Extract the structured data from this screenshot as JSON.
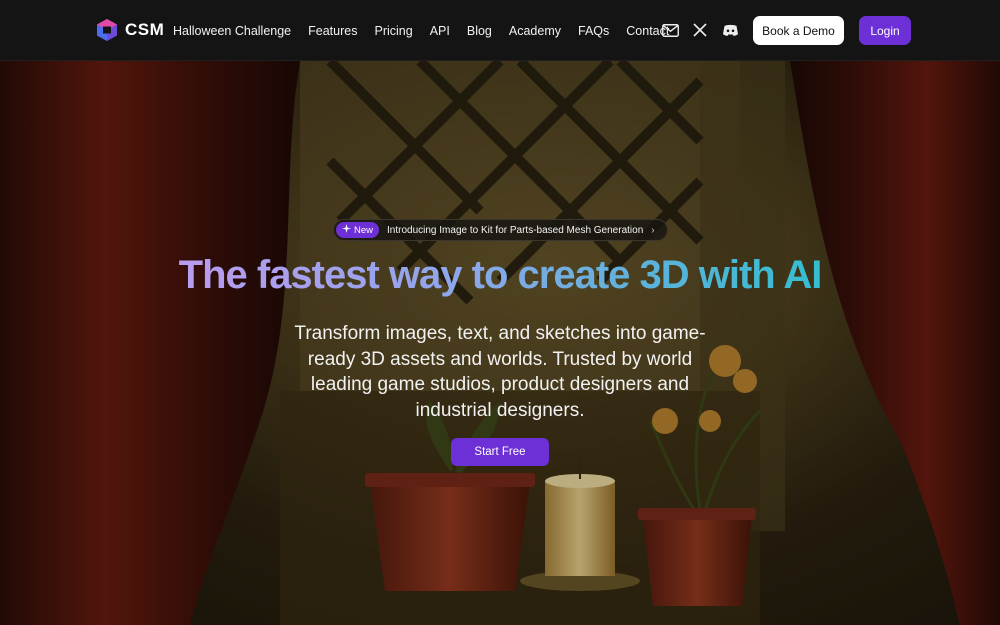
{
  "brand": {
    "name": "CSM"
  },
  "nav": {
    "items": [
      {
        "label": "Halloween Challenge"
      },
      {
        "label": "Features"
      },
      {
        "label": "Pricing"
      },
      {
        "label": "API"
      },
      {
        "label": "Blog"
      },
      {
        "label": "Academy"
      },
      {
        "label": "FAQs"
      },
      {
        "label": "Contact"
      }
    ],
    "social_icons": [
      "mail-icon",
      "x-icon",
      "discord-icon"
    ],
    "demo_label": "Book a Demo",
    "login_label": "Login"
  },
  "announcement": {
    "badge": "New",
    "text": "Introducing Image to Kit for Parts-based Mesh Generation",
    "chevron": "›"
  },
  "hero": {
    "headline": "The fastest way to create 3D with AI",
    "subtitle": "Transform  images, text, and sketches into game-ready 3D assets and worlds. Trusted by world leading game studios, product designers and industrial designers.",
    "cta_label": "Start Free"
  },
  "colors": {
    "accent": "#6d2fd6",
    "nav_bg": "#141414",
    "headline_start": "#b79cf0",
    "headline_end": "#2fbfcf"
  }
}
